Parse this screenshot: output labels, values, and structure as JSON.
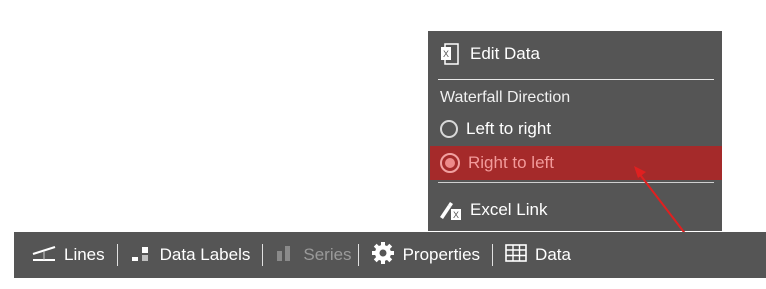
{
  "menu": {
    "edit_data": "Edit Data",
    "section_title": "Waterfall Direction",
    "options": [
      {
        "label": "Left to right",
        "selected": false
      },
      {
        "label": "Right to left",
        "selected": true
      }
    ],
    "excel_link": "Excel Link"
  },
  "toolbar": {
    "lines": "Lines",
    "data_labels": "Data Labels",
    "series": "Series",
    "properties": "Properties",
    "data": "Data"
  },
  "colors": {
    "menu_bg": "#555555",
    "highlight": "#a52a2a",
    "arrow": "#e02020"
  }
}
